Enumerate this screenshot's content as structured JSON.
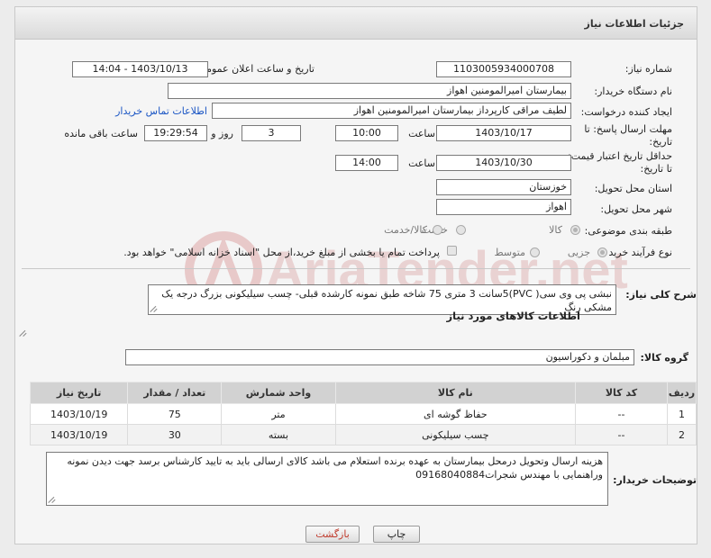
{
  "header": {
    "title": "جزئیات اطلاعات نیاز"
  },
  "fields": {
    "need_number_label": "شماره نیاز:",
    "need_number": "1103005934000708",
    "announce_label": "تاریخ و ساعت اعلان عمومی:",
    "announce_value": "1403/10/13 - 14:04",
    "buyer_org_label": "نام دستگاه خریدار:",
    "buyer_org": "بیمارستان امیرالمومنین اهواز",
    "requester_label": "ایجاد کننده درخواست:",
    "requester": "لطیف مراقی کارپرداز بیمارستان امیرالمومنین اهواز",
    "contact_link": "اطلاعات تماس خریدار",
    "reply_deadline_label": "مهلت ارسال پاسخ: تا تاریخ:",
    "reply_date": "1403/10/17",
    "time_label": "ساعت",
    "reply_time": "10:00",
    "days_value": "3",
    "days_label": "روز و",
    "remaining_time": "19:29:54",
    "remaining_label": "ساعت باقی مانده",
    "price_validity_label": "حداقل تاریخ اعتبار قیمت: تا تاریخ:",
    "price_date": "1403/10/30",
    "price_time": "14:00",
    "province_label": "استان محل تحویل:",
    "province": "خوزستان",
    "city_label": "شهر محل تحویل:",
    "city": "اهواز",
    "category_label": "طبقه بندی موضوعی:",
    "category_options": [
      "کالا",
      "خدمت",
      "کالا/خدمت"
    ],
    "process_label": "نوع فرآیند خرید :",
    "process_options": [
      "جزیی",
      "متوسط"
    ],
    "payment_note": "پرداخت تمام یا بخشی از مبلغ خرید،از محل \"اسناد خزانه اسلامی\" خواهد بود."
  },
  "description": {
    "label": "شرح کلی نیاز:",
    "text": "نبشی پی وی سی( PVC)5سانت 3 متری 75 شاخه طبق نمونه کارشده قبلی- چسب سیلیکونی بزرگ درجه یک مشکی رنگ"
  },
  "goods": {
    "section_title": "اطلاعات کالاهای مورد نیاز",
    "group_label": "گروه کالا:",
    "group_value": "مبلمان و دکوراسیون",
    "columns": [
      "ردیف",
      "کد کالا",
      "نام کالا",
      "واحد شمارش",
      "تعداد / مقدار",
      "تاریخ نیاز"
    ],
    "rows": [
      {
        "row": "1",
        "code": "--",
        "name": "حفاظ گوشه ای",
        "unit": "متر",
        "qty": "75",
        "date": "1403/10/19"
      },
      {
        "row": "2",
        "code": "--",
        "name": "چسب سیلیکونی",
        "unit": "بسته",
        "qty": "30",
        "date": "1403/10/19"
      }
    ]
  },
  "buyer_notes": {
    "label": "توضیحات خریدار:",
    "text": "هزینه ارسال وتحویل درمحل بیمارستان به عهده برنده استعلام می باشد کالای ارسالی باید به تایید کارشناس برسد جهت دیدن نمونه وراهنمایی با مهندس شجرات09168040884"
  },
  "buttons": {
    "print": "چاپ",
    "back": "بازگشت"
  },
  "watermark": {
    "text": "AriaTender.net",
    "color": "#e6c4c4"
  }
}
